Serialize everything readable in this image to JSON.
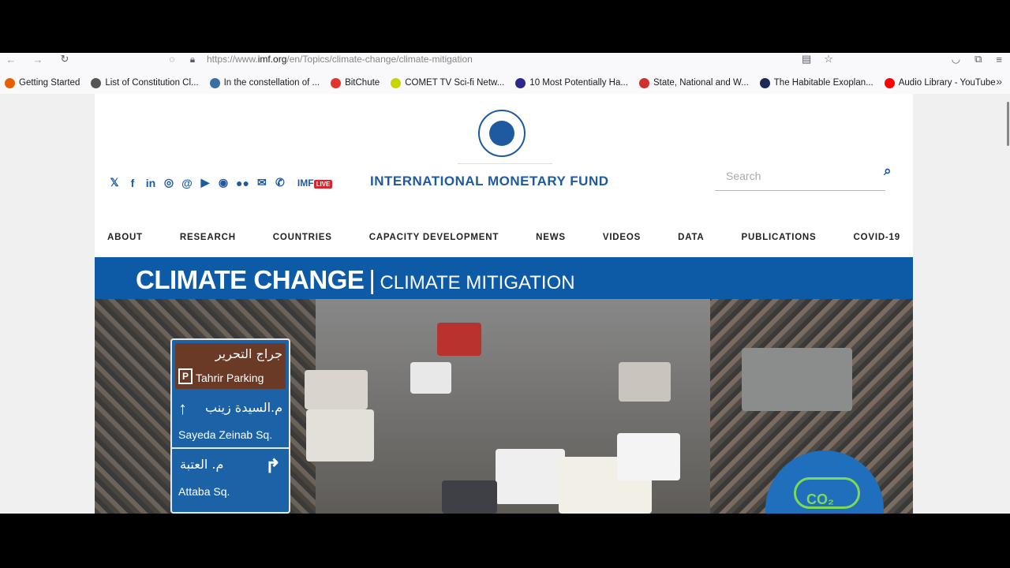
{
  "browser": {
    "url_prefix": "https://www.",
    "url_domain": "imf.org",
    "url_path": "/en/Topics/climate-change/climate-mitigation",
    "bookmarks": [
      {
        "label": "Getting Started",
        "color": "#e66000"
      },
      {
        "label": "List of Constitution Cl...",
        "color": "#555555"
      },
      {
        "label": "In the constellation of ...",
        "color": "#3a6ea5"
      },
      {
        "label": "BitChute",
        "color": "#e0342c"
      },
      {
        "label": "COMET TV Sci-fi Netw...",
        "color": "#c8d400"
      },
      {
        "label": "10 Most Potentially Ha...",
        "color": "#2a2a8c"
      },
      {
        "label": "State, National and W...",
        "color": "#d03030"
      },
      {
        "label": "The Habitable Exoplan...",
        "color": "#1d2a55"
      },
      {
        "label": "Audio Library - YouTube",
        "color": "#ff0000"
      }
    ]
  },
  "site": {
    "brand": "INTERNATIONAL MONETARY FUND",
    "imf_live_prefix": "IMF",
    "imf_live_badge": "LIVE",
    "search_placeholder": "Search",
    "nav": [
      "ABOUT",
      "RESEARCH",
      "COUNTRIES",
      "CAPACITY DEVELOPMENT",
      "NEWS",
      "VIDEOS",
      "DATA",
      "PUBLICATIONS",
      "COVID-19"
    ],
    "banner_title": "CLIMATE CHANGE",
    "banner_separator": "|",
    "banner_subtitle": "CLIMATE MITIGATION",
    "accent_color": "#0d5aa7"
  },
  "photo": {
    "sign_arabic_1": "جراج التحرير",
    "sign_parking": "Tahrir Parking",
    "sign_p": "P",
    "sign_arabic_2": "م.السيدة زينب",
    "sign_english_1": "Sayeda Zeinab Sq.",
    "sign_arabic_3": "م. العتبة",
    "sign_english_2": "Attaba Sq.",
    "co2_label": "CO₂"
  }
}
